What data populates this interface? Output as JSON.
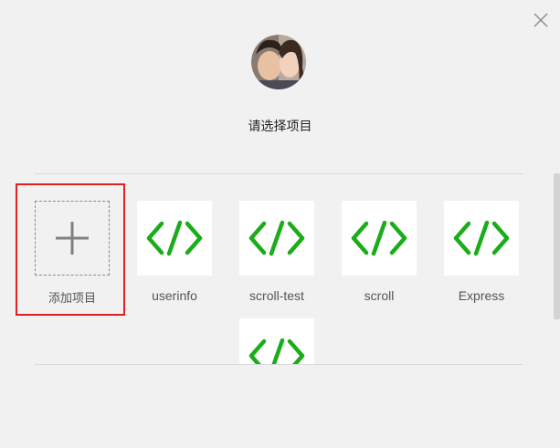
{
  "dialog": {
    "title": "请选择项目",
    "close_icon": "close-icon",
    "avatar_icon": "user-avatar"
  },
  "add_project": {
    "label": "添加项目",
    "icon": "plus-icon"
  },
  "projects": [
    {
      "label": "userinfo",
      "icon": "code-icon"
    },
    {
      "label": "scroll-test",
      "icon": "code-icon"
    },
    {
      "label": "scroll",
      "icon": "code-icon"
    },
    {
      "label": "Express",
      "icon": "code-icon"
    },
    {
      "label": "",
      "icon": "code-icon"
    }
  ],
  "colors": {
    "accent_green": "#1aad19",
    "highlight_red": "#e02020",
    "background": "#f1f1f1"
  }
}
